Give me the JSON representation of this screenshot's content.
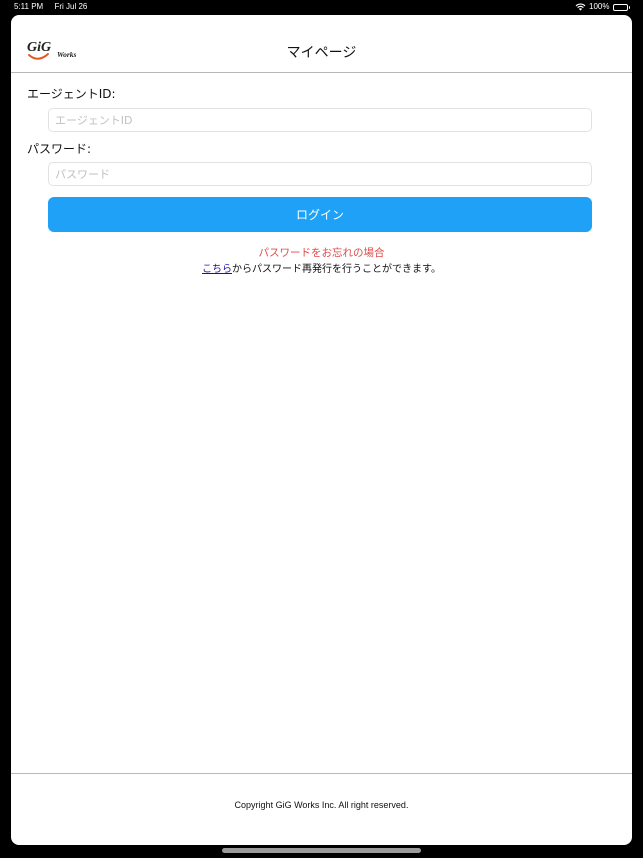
{
  "status_bar": {
    "time": "5:11 PM",
    "date": "Fri Jul 26",
    "battery": "100%",
    "battery_level": 1.0
  },
  "header": {
    "title": "マイページ",
    "logo": {
      "main": "GiG",
      "sub": "Works",
      "main_color": "#222222",
      "accent_color": "#e8561e"
    }
  },
  "form": {
    "agent_id_label": "エージェントID:",
    "agent_id_placeholder": "エージェントID",
    "agent_id_value": "",
    "password_label": "パスワード:",
    "password_placeholder": "パスワード",
    "password_value": "",
    "login_label": "ログイン",
    "button_color": "#1ea1f7"
  },
  "forgot": {
    "title": "パスワードをお忘れの場合",
    "link_text": "こちら",
    "desc": "からパスワード再発行を行うことができます。",
    "title_color": "#e04a4a"
  },
  "footer": {
    "copyright": "Copyright GiG Works Inc. All right reserved."
  }
}
